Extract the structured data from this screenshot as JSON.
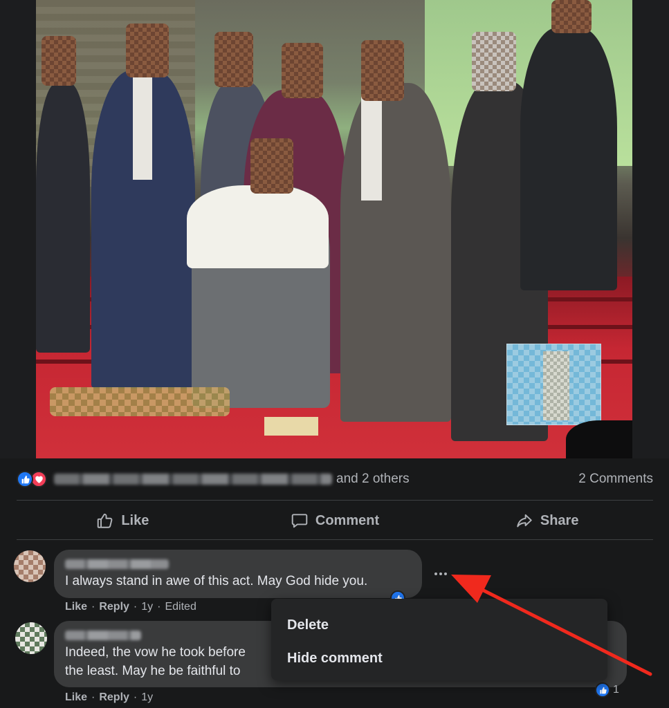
{
  "post": {
    "photo_alt": "",
    "reactions": {
      "icons": [
        "like-icon",
        "love-icon"
      ],
      "others_text": "and 2 others",
      "comments_count": "2 Comments"
    },
    "actions": [
      {
        "label": "Like",
        "icon": "thumbs-up-icon"
      },
      {
        "label": "Comment",
        "icon": "speech-bubble-icon"
      },
      {
        "label": "Share",
        "icon": "share-arrow-icon"
      }
    ]
  },
  "comments": [
    {
      "text": "I always stand in awe of this act. May God hide you.",
      "like_label": "Like",
      "reply_label": "Reply",
      "time": "1y",
      "edited": "Edited",
      "reaction_count": ""
    },
    {
      "text_line1": "Indeed, the vow he took before",
      "text_line2": "the least. May he be faithful to",
      "like_label": "Like",
      "reply_label": "Reply",
      "time": "1y",
      "reaction_count": "1"
    }
  ],
  "menu": {
    "items": [
      "Delete",
      "Hide comment"
    ]
  },
  "colors": {
    "background": "#18191a",
    "bubble": "#3a3b3c",
    "accent_blue": "#2078f4",
    "love_red": "#f33e58",
    "annotation_arrow": "#f0291d"
  }
}
